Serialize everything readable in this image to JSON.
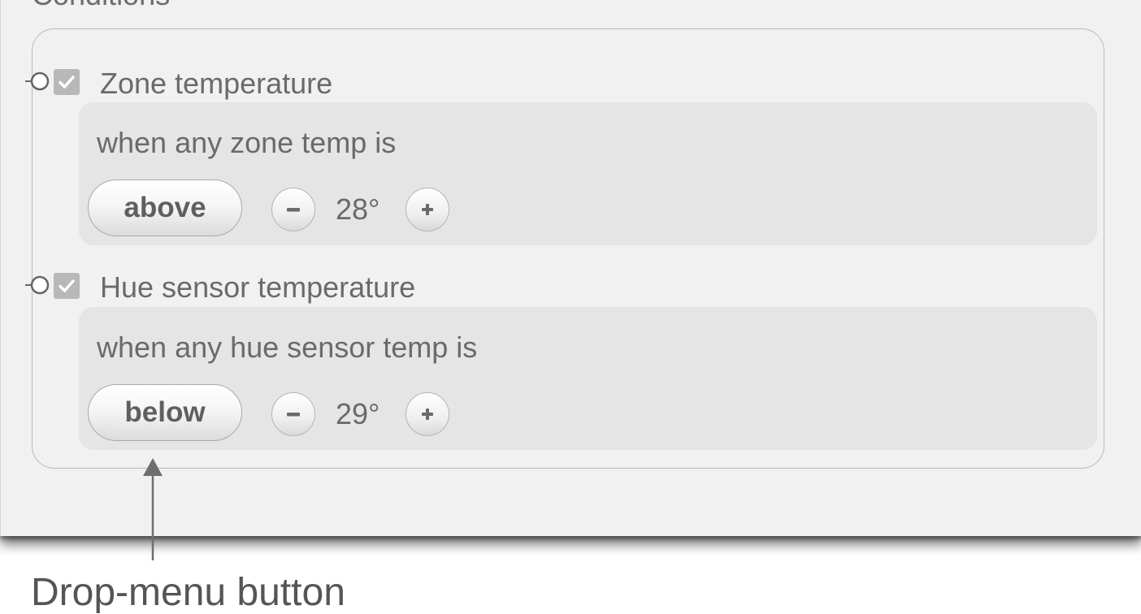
{
  "section": {
    "title": "Conditions"
  },
  "conditions": [
    {
      "label": "Zone temperature",
      "checked": true,
      "description": "when any zone temp is",
      "comparator": "above",
      "value": "28°",
      "decrement_icon": "minus-icon",
      "increment_icon": "plus-icon"
    },
    {
      "label": "Hue sensor temperature",
      "checked": true,
      "description": "when any hue sensor temp is",
      "comparator": "below",
      "value": "29°",
      "decrement_icon": "minus-icon",
      "increment_icon": "plus-icon"
    }
  ],
  "annotation": {
    "callout": "Drop-menu button"
  },
  "colors": {
    "panel_background": "#f1f1f1",
    "condition_background": "#e5e5e5",
    "checkbox": "#b8b8b8",
    "text": "#6a6a6a"
  }
}
